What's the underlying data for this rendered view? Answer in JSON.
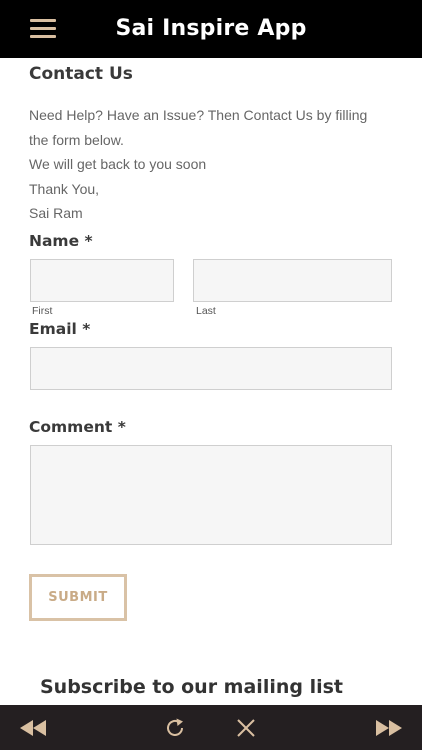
{
  "header": {
    "title": "Sai Inspire App",
    "menu_icon": "hamburger-menu-icon",
    "menu_color": "#d9bfa1"
  },
  "page": {
    "heading": "Contact Us",
    "intro_lines": [
      "Need Help? Have an Issue? Then Contact Us by filling the form below.",
      "We will get back to you soon",
      "Thank You,",
      "Sai Ram"
    ]
  },
  "form": {
    "name_label": "Name",
    "email_label": "Email",
    "comment_label": "Comment",
    "required_mark": "*",
    "first_sublabel": "First",
    "last_sublabel": "Last",
    "first_value": "",
    "last_value": "",
    "email_value": "",
    "comment_value": "",
    "submit_label": "SUBMIT",
    "accent_color": "#d9c2a6"
  },
  "footer_section": {
    "subscribe_heading": "Subscribe to our mailing list"
  },
  "bottom_nav": {
    "back_icon": "rewind-icon",
    "reload_icon": "reload-icon",
    "close_icon": "close-icon",
    "forward_icon": "fast-forward-icon",
    "background": "#241f21"
  }
}
